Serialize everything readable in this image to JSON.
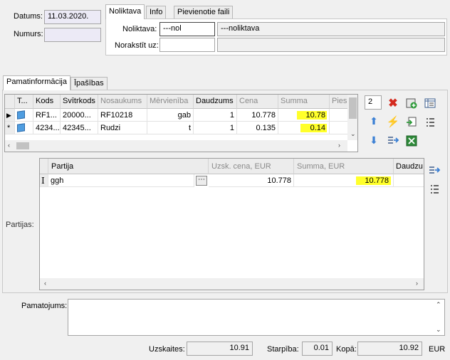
{
  "header": {
    "datums_label": "Datums:",
    "datums_value": "11.03.2020.",
    "numurs_label": "Numurs:",
    "numurs_value": ""
  },
  "top_tabs": [
    "Noliktava",
    "Info",
    "Pievienotie faili"
  ],
  "noliktava": {
    "label": "Noliktava:",
    "code": "---nol",
    "name": "---noliktava",
    "norakstit_label": "Norakstīt uz:",
    "norakstit_code": "",
    "norakstit_name": ""
  },
  "main_tabs": [
    "Pamatinformācija",
    "Īpašības"
  ],
  "items_grid": {
    "columns": [
      "T...",
      "Kods",
      "Svītrkods",
      "Nosaukums",
      "Mērvienība",
      "Daudzums",
      "Cena",
      "Summa",
      "Piesl"
    ],
    "rows": [
      {
        "marker": "▶",
        "kods": "RF1...",
        "svitrkods": "20000...",
        "nosaukums": "RF10218",
        "mervieniba": "gab",
        "daudzums": "1",
        "cena": "10.778",
        "summa": "10.78"
      },
      {
        "marker": "*",
        "kods": "4234...",
        "svitrkods": "42345...",
        "nosaukums": "Rudzi",
        "mervieniba": "t",
        "daudzums": "1",
        "cena": "0.135",
        "summa": "0.14"
      }
    ],
    "count": "2"
  },
  "partijas": {
    "label": "Partijas:",
    "columns": [
      "Partija",
      "Uzsk. cena, EUR",
      "Summa, EUR",
      "Daudzu"
    ],
    "rows": [
      {
        "marker": "I",
        "partija": "ggh",
        "uzsk_cena": "10.778",
        "summa": "10.778"
      }
    ]
  },
  "pamatojums": {
    "label": "Pamatojums:",
    "value": ""
  },
  "footer": {
    "uzskaites_label": "Uzskaites:",
    "uzskaites_value": "10.91",
    "starpiba_label": "Starpība:",
    "starpiba_value": "0.01",
    "kopa_label": "Kopā:",
    "kopa_value": "10.92",
    "currency": "EUR"
  },
  "colors": {
    "highlight": "#ffff2a",
    "arrow_blue": "#3a7fd4",
    "delete_red": "#d42a1e",
    "bolt_orange": "#e89a10"
  }
}
